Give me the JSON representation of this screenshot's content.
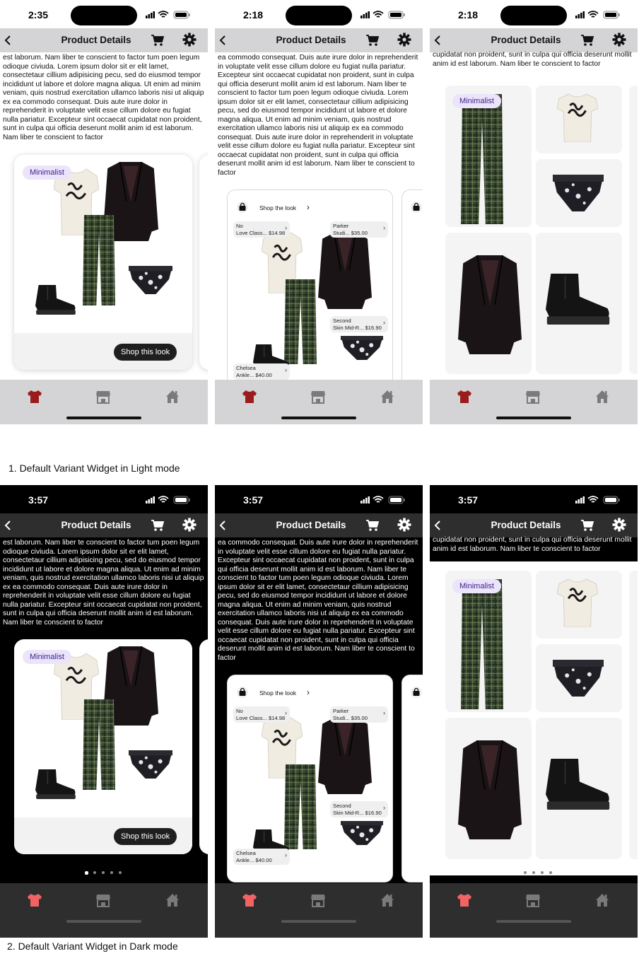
{
  "screens": {
    "light": [
      {
        "time": "2:35"
      },
      {
        "time": "2:18"
      },
      {
        "time": "2:18"
      }
    ],
    "dark": [
      {
        "time": "3:57"
      },
      {
        "time": "3:57"
      },
      {
        "time": "3:57"
      }
    ]
  },
  "nav": {
    "title": "Product Details",
    "back_icon": "chevron-left-icon",
    "cart_icon": "cart-icon",
    "settings_icon": "gear-icon"
  },
  "paragraphs": {
    "p1": "est laborum. Nam liber te conscient to factor tum poen legum odioque civiuda. Lorem ipsum dolor sit er elit lamet, consectetaur cillium adipisicing pecu, sed do eiusmod tempor incididunt ut labore et dolore magna aliqua. Ut enim ad minim veniam, quis nostrud exercitation ullamco laboris nisi ut aliquip ex ea commodo consequat. Duis aute irure dolor in reprehenderit in voluptate velit esse cillum dolore eu fugiat nulla pariatur. Excepteur sint occaecat cupidatat non proident, sunt in culpa qui officia deserunt mollit anim id est laborum. Nam liber te conscient to factor",
    "p2": "ea commodo consequat. Duis aute irure dolor in reprehenderit in voluptate velit esse cillum dolore eu fugiat nulla pariatur. Excepteur sint occaecat cupidatat non proident, sunt in culpa qui officia deserunt mollit anim id est laborum. Nam liber te conscient to factor tum poen legum odioque civiuda. Lorem ipsum dolor sit er elit lamet, consectetaur cillium adipisicing pecu, sed do eiusmod tempor incididunt ut labore et dolore magna aliqua. Ut enim ad minim veniam, quis nostrud exercitation ullamco laboris nisi ut aliquip ex ea commodo consequat. Duis aute irure dolor in reprehenderit in voluptate velit esse cillum dolore eu fugiat nulla pariatur. Excepteur sint occaecat cupidatat non proident, sunt in culpa qui officia deserunt mollit anim id est laborum. Nam liber te conscient to factor",
    "p3": "cupidatat non proident, sunt in culpa qui officia deserunt mollit anim id est laborum. Nam liber te conscient to factor"
  },
  "widget": {
    "style_tag": "Minimalist",
    "shop_button": "Shop this look",
    "shop_the_look": "Shop the look",
    "carousel_pages": 5,
    "carousel_active": 1,
    "products": [
      {
        "name": "No Love Class...",
        "price": "$14.98"
      },
      {
        "name": "Parker Studi...",
        "price": "$35.00"
      },
      {
        "name": "Second Skin Mid-R...",
        "price": "$16.90"
      },
      {
        "name": "Chelsea Ankle...",
        "price": "$40.00"
      }
    ]
  },
  "tabbar": {
    "items": [
      "shirt-icon",
      "store-icon",
      "home-icon"
    ],
    "active_color_light": "#9b1c1c",
    "active_color_dark": "#f26464",
    "inactive_color": "#7a7a7a"
  },
  "captions": {
    "light": "1. Default Variant Widget in Light mode",
    "dark": "2. Default Variant Widget in Dark mode"
  }
}
